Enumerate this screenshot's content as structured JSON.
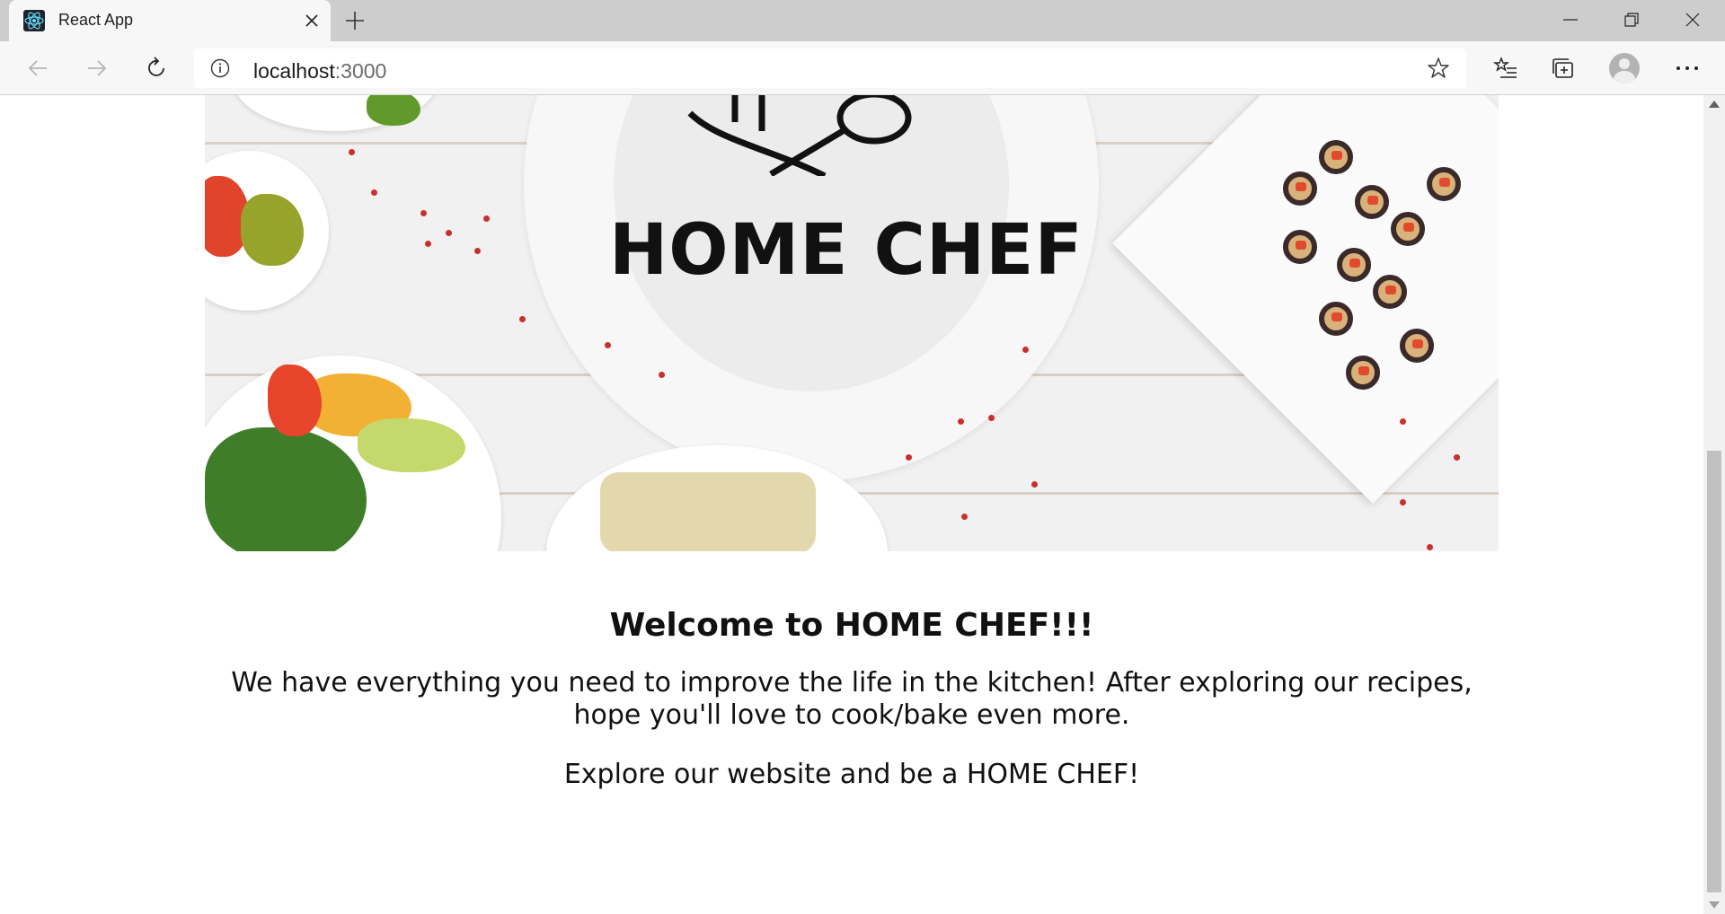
{
  "browser": {
    "tab_title": "React App",
    "url_host": "localhost",
    "url_port": ":3000",
    "icons": {
      "favicon": "react-logo-icon",
      "tab_close": "close-icon",
      "new_tab": "plus-icon",
      "back": "arrow-left-icon",
      "forward": "arrow-right-icon",
      "refresh": "refresh-icon",
      "site_info": "info-icon",
      "favorite": "star-icon",
      "favorites": "favorites-list-icon",
      "collections": "collections-icon",
      "profile": "avatar-icon",
      "menu": "more-icon",
      "minimize": "minimize-icon",
      "restore": "restore-icon",
      "close_window": "close-icon"
    }
  },
  "page": {
    "hero_logo_text": "HOME CHEF",
    "welcome_heading": "Welcome to HOME CHEF!!!",
    "intro_text": "We have everything you need to improve the life in the kitchen! After exploring our recipes, hope you'll love to cook/bake even more.",
    "explore_text": "Explore our website and be a HOME CHEF!"
  },
  "colors": {
    "accent_react": "#61dafb",
    "text": "#111111",
    "titlebar": "#cdcdcd",
    "toolbar": "#f7f7f7"
  }
}
